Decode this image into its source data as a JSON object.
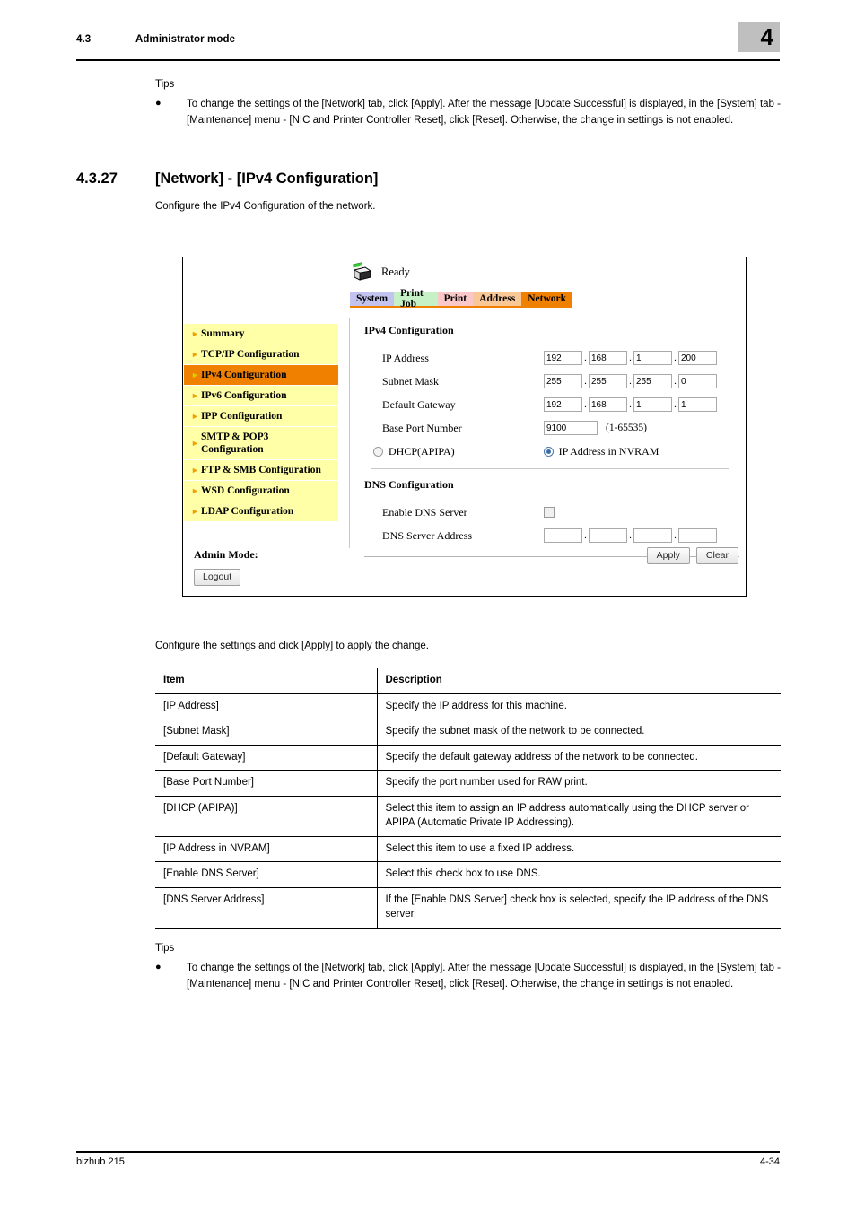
{
  "header": {
    "section_number": "4.3",
    "section_title": "Administrator mode",
    "chapter": "4"
  },
  "tips_top": {
    "label": "Tips",
    "bullet": "●",
    "text": "To change the settings of the [Network] tab, click [Apply]. After the message [Update Successful] is displayed, in the [System] tab - [Maintenance] menu - [NIC and Printer Controller Reset], click [Reset]. Otherwise, the change in settings is not enabled."
  },
  "section": {
    "number": "4.3.27",
    "title": "[Network] - [IPv4 Configuration]",
    "description": "Configure the IPv4 Configuration of the network."
  },
  "screenshot": {
    "status": "Ready",
    "printer_icon": "printer-icon",
    "tabs": [
      {
        "label": "System",
        "color": "#c3c3f0",
        "active": false
      },
      {
        "label": "Print Job",
        "color": "#c6f0c6",
        "active": false
      },
      {
        "label": "Print",
        "color": "#fac8c8",
        "active": false
      },
      {
        "label": "Address",
        "color": "#fac896",
        "active": false
      },
      {
        "label": "Network",
        "color": "#f08000",
        "active": true
      }
    ],
    "sidebar": [
      {
        "label": "Summary",
        "active": false
      },
      {
        "label": "TCP/IP Configuration",
        "active": false
      },
      {
        "label": "IPv4 Configuration",
        "active": true
      },
      {
        "label": "IPv6 Configuration",
        "active": false
      },
      {
        "label": "IPP Configuration",
        "active": false
      },
      {
        "label": "SMTP & POP3 Configuration",
        "active": false
      },
      {
        "label": "FTP & SMB Configuration",
        "active": false
      },
      {
        "label": "WSD Configuration",
        "active": false
      },
      {
        "label": "LDAP Configuration",
        "active": false
      }
    ],
    "admin": {
      "mode_label": "Admin Mode:",
      "logout_label": "Logout"
    },
    "ipv4": {
      "heading": "IPv4 Configuration",
      "ip_address_label": "IP Address",
      "ip_address": [
        "192",
        "168",
        "1",
        "200"
      ],
      "subnet_mask_label": "Subnet Mask",
      "subnet_mask": [
        "255",
        "255",
        "255",
        "0"
      ],
      "default_gateway_label": "Default Gateway",
      "default_gateway": [
        "192",
        "168",
        "1",
        "1"
      ],
      "base_port_label": "Base Port Number",
      "base_port_value": "9100",
      "base_port_hint": "(1-65535)",
      "dhcp_label": "DHCP(APIPA)",
      "dhcp_selected": false,
      "nvram_label": "IP Address in NVRAM",
      "nvram_selected": true
    },
    "dns": {
      "heading": "DNS Configuration",
      "enable_label": "Enable DNS Server",
      "enable_checked": false,
      "address_label": "DNS Server Address",
      "address": [
        "",
        "",
        "",
        ""
      ]
    },
    "buttons": {
      "apply": "Apply",
      "clear": "Clear"
    }
  },
  "caption": "Configure the settings and click [Apply] to apply the change.",
  "table": {
    "headers": [
      "Item",
      "Description"
    ],
    "rows": [
      [
        "[IP Address]",
        "Specify the IP address for this machine."
      ],
      [
        "[Subnet Mask]",
        "Specify the subnet mask of the network to be connected."
      ],
      [
        "[Default Gateway]",
        "Specify the default gateway address of the network to be connected."
      ],
      [
        "[Base Port Number]",
        "Specify the port number used for RAW print."
      ],
      [
        "[DHCP (APIPA)]",
        "Select this item to assign an IP address automatically using the DHCP server or APIPA (Automatic Private IP Addressing)."
      ],
      [
        "[IP Address in NVRAM]",
        "Select this item to use a fixed IP address."
      ],
      [
        "[Enable DNS Server]",
        "Select this check box to use DNS."
      ],
      [
        "[DNS Server Address]",
        "If the [Enable DNS Server] check box is selected, specify the IP address of the DNS server."
      ]
    ]
  },
  "tips_bottom": {
    "label": "Tips",
    "bullet": "●",
    "text": "To change the settings of the [Network] tab, click [Apply]. After the message [Update Successful] is displayed, in the [System] tab - [Maintenance] menu - [NIC and Printer Controller Reset], click [Reset]. Otherwise, the change in settings is not enabled."
  },
  "footer": {
    "product": "bizhub 215",
    "page": "4-34"
  }
}
